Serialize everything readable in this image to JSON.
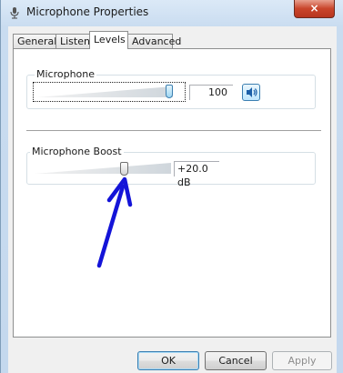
{
  "window": {
    "title": "Microphone Properties",
    "icons": {
      "app": "microphone-icon",
      "close": "close-icon"
    },
    "close_label": "×"
  },
  "tabs": [
    {
      "label": "General",
      "active": false
    },
    {
      "label": "Listen",
      "active": false
    },
    {
      "label": "Levels",
      "active": true
    },
    {
      "label": "Advanced",
      "active": false
    }
  ],
  "levels": {
    "microphone": {
      "label": "Microphone",
      "value": "100",
      "level": 1.0,
      "mute_icon": "speaker-icon"
    },
    "boost": {
      "label": "Microphone Boost",
      "value": "+20.0 dB",
      "level": 0.67
    }
  },
  "annotation": {
    "icon": "arrow-icon",
    "color": "#1414d8"
  },
  "buttons": {
    "ok": "OK",
    "cancel": "Cancel",
    "apply": "Apply"
  },
  "colors": {
    "accent": "#3c7fb1",
    "close": "#c9452b"
  }
}
